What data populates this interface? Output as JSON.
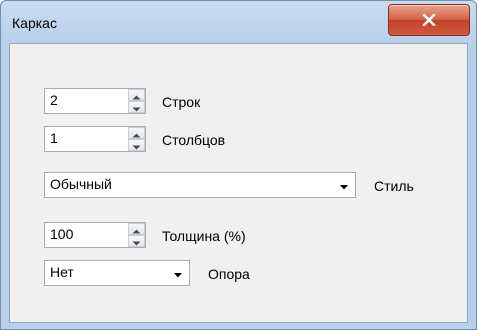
{
  "window": {
    "title": "Каркас"
  },
  "rows": {
    "value": "2",
    "label": "Строк"
  },
  "columns": {
    "value": "1",
    "label": "Столбцов"
  },
  "style": {
    "selected": "Обычный",
    "label": "Стиль"
  },
  "thickness": {
    "value": "100",
    "label": "Толщина (%)"
  },
  "support": {
    "selected": "Нет",
    "label": "Опора"
  },
  "icons": {
    "close": "close-x-icon",
    "spin_up": "up-arrow-icon",
    "spin_down": "down-arrow-icon",
    "dropdown": "chevron-down-icon"
  }
}
